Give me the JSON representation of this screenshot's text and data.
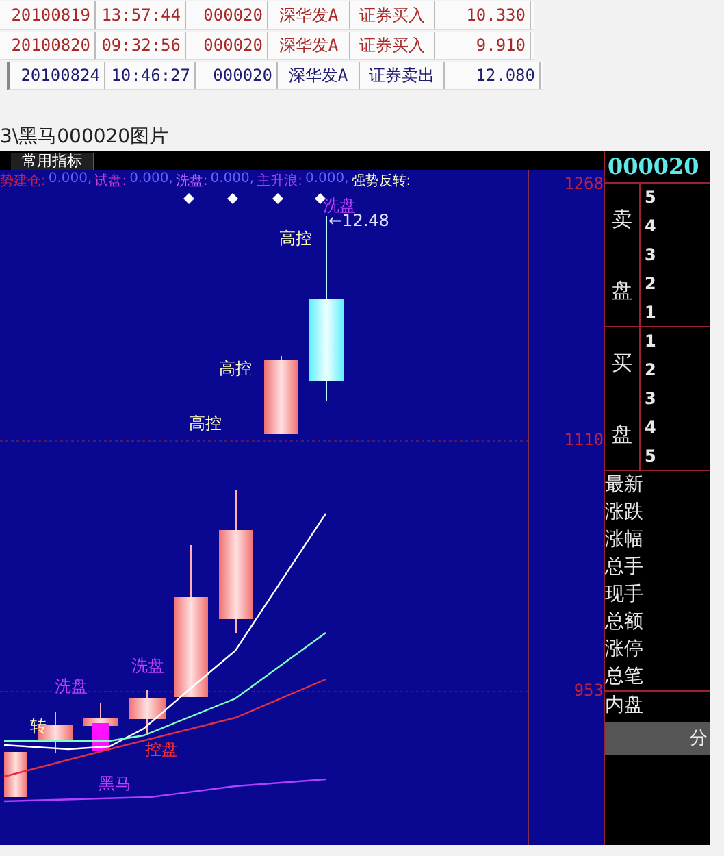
{
  "trades": [
    {
      "date": "20100819",
      "time": "13:57:44",
      "code": "000020",
      "name": "深华发A",
      "action": "证券买入",
      "price": "10.330",
      "color": "#a82828"
    },
    {
      "date": "20100820",
      "time": "09:32:56",
      "code": "000020",
      "name": "深华发A",
      "action": "证券买入",
      "price": "9.910",
      "color": "#a82828"
    },
    {
      "date": "20100824",
      "time": "10:46:27",
      "code": "000020",
      "name": "深华发A",
      "action": "证券卖出",
      "price": "12.080",
      "color": "#1c1c70"
    }
  ],
  "image_title": "3\\黑马000020图片",
  "chart": {
    "tab": "常用指标",
    "indicators": [
      {
        "label": "势建仓:",
        "value": "0.000,",
        "color": "#d02048"
      },
      {
        "label": "试盘:",
        "value": "0.000,",
        "color": "#d040d0"
      },
      {
        "label": "洗盘:",
        "value": "0.000,",
        "color": "#c060ff"
      },
      {
        "label": "主升浪:",
        "value": "0.000,",
        "color": "#a040f0"
      },
      {
        "label": "强势反转:",
        "color": "#ffffc8"
      }
    ],
    "price_labels": [
      "1268",
      "1110",
      "953"
    ],
    "annotations": [
      {
        "text": "洗盘",
        "color": "#c040ff"
      },
      {
        "text": "←12.48",
        "color": "#e0e0ff"
      },
      {
        "text": "高控",
        "color": "#ffffc0"
      },
      {
        "text": "高控",
        "color": "#ffffc0"
      },
      {
        "text": "高控",
        "color": "#ffffc0"
      },
      {
        "text": "洗盘",
        "color": "#c040ff"
      },
      {
        "text": "洗盘",
        "color": "#c040ff"
      },
      {
        "text": "控盘",
        "color": "#ff3030"
      },
      {
        "text": "转",
        "color": "#ffffc0"
      },
      {
        "text": "黑马",
        "color": "#c040ff"
      }
    ]
  },
  "quote": {
    "code": "000020",
    "sell_label": "卖盘",
    "sell_levels": [
      "5",
      "4",
      "3",
      "2",
      "1"
    ],
    "buy_label": "买盘",
    "buy_levels": [
      "1",
      "2",
      "3",
      "4",
      "5"
    ],
    "fields": [
      "最新",
      "涨跌",
      "涨幅",
      "总手",
      "现手",
      "总额",
      "涨停",
      "总笔"
    ],
    "inner": "内盘",
    "tab": "分"
  }
}
